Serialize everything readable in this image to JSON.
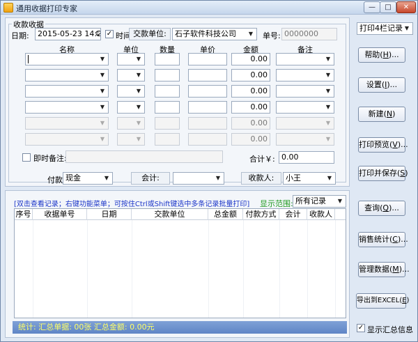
{
  "window": {
    "title": "通用收据打印专家",
    "min": "—",
    "max": "□",
    "close": "✕"
  },
  "receipt": {
    "legend": "收款收据",
    "date_label": "日期:",
    "date_value": "2015-05-23 14:25:",
    "time_label": "时间",
    "payer_label": "交款单位:",
    "payer_value": "石子软件科技公司",
    "number_label": "单号:",
    "number_value": "0000000",
    "columns": [
      "名称",
      "单位",
      "数量",
      "单价",
      "金额",
      "备注"
    ],
    "rows": [
      {
        "amount": "0.00",
        "enabled": true
      },
      {
        "amount": "0.00",
        "enabled": true
      },
      {
        "amount": "0.00",
        "enabled": true
      },
      {
        "amount": "0.00",
        "enabled": true
      },
      {
        "amount": "0.00",
        "enabled": false
      },
      {
        "amount": "0.00",
        "enabled": false
      }
    ],
    "memo_label": "即时备注:",
    "total_label": "合计￥:",
    "total_value": "0.00",
    "payment_method_label": "付款方式:",
    "payment_method_value": "现金",
    "accountant_label": "会计:",
    "accountant_value": "",
    "receiver_label": "收款人:",
    "receiver_value": "小王"
  },
  "right_panel": {
    "print_mode": "打印4栏记录",
    "buttons": [
      {
        "text": "帮助(",
        "key": "H",
        "tail": ")..."
      },
      {
        "text": "设置(",
        "key": "I",
        "tail": ")..."
      },
      {
        "text": "新建(",
        "key": "N",
        "tail": ")"
      },
      {
        "text": "打印预览(",
        "key": "V",
        "tail": ")..."
      },
      {
        "text": "打印并保存(",
        "key": "S",
        "tail": ")"
      },
      {
        "text": "查询(",
        "key": "Q",
        "tail": ")..."
      },
      {
        "text": "销售统计(",
        "key": "C",
        "tail": ")..."
      },
      {
        "text": "管理数据(",
        "key": "M",
        "tail": ")..."
      },
      {
        "text": "导出到EXCEL(",
        "key": "E",
        "tail": ")"
      }
    ],
    "show_summary_label": "显示汇总信息"
  },
  "records": {
    "hint": "[双击查看记录；右键功能菜单；可按住Ctrl或Shift键选中多条记录批量打印]",
    "range_label": "显示范围:",
    "range_value": "所有记录",
    "columns": [
      "序号",
      "收据单号",
      "日期",
      "交款单位",
      "总金额",
      "付款方式",
      "会计",
      "收款人"
    ]
  },
  "status": {
    "text": "统计:   汇总单据: 00张      汇总金额: 0.00元"
  },
  "colors": {
    "hint_text": "#1a34c8",
    "range_label": "#1f9a1f",
    "status_bg": "#6a8fcc",
    "status_text": "#ffff66"
  },
  "icons": {
    "checkbox": "✓",
    "dropdown": "▼",
    "spin": "⇕"
  }
}
